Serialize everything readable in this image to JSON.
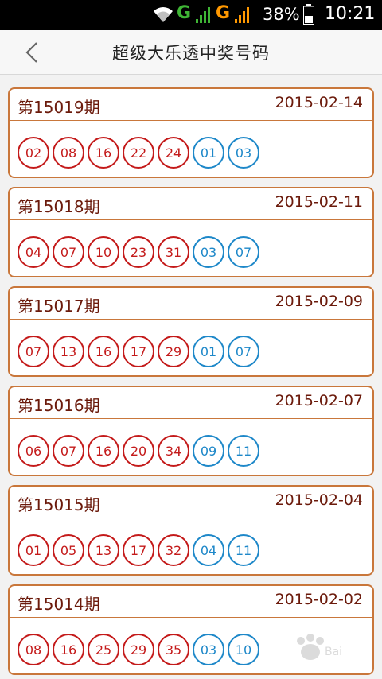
{
  "status": {
    "network1": "G",
    "network2": "G",
    "battery_percent": "38%",
    "time": "10:21"
  },
  "header": {
    "back_icon": "chevron-left-icon",
    "title": "超级大乐透中奖号码"
  },
  "draws": [
    {
      "issue": "第15019期",
      "date": "2015-02-14",
      "front": [
        "02",
        "08",
        "16",
        "22",
        "24"
      ],
      "back": [
        "01",
        "03"
      ]
    },
    {
      "issue": "第15018期",
      "date": "2015-02-11",
      "front": [
        "04",
        "07",
        "10",
        "23",
        "31"
      ],
      "back": [
        "03",
        "07"
      ]
    },
    {
      "issue": "第15017期",
      "date": "2015-02-09",
      "front": [
        "07",
        "13",
        "16",
        "17",
        "29"
      ],
      "back": [
        "01",
        "07"
      ]
    },
    {
      "issue": "第15016期",
      "date": "2015-02-07",
      "front": [
        "06",
        "07",
        "16",
        "20",
        "34"
      ],
      "back": [
        "09",
        "11"
      ]
    },
    {
      "issue": "第15015期",
      "date": "2015-02-04",
      "front": [
        "01",
        "05",
        "13",
        "17",
        "32"
      ],
      "back": [
        "04",
        "11"
      ]
    },
    {
      "issue": "第15014期",
      "date": "2015-02-02",
      "front": [
        "08",
        "16",
        "25",
        "29",
        "35"
      ],
      "back": [
        "03",
        "10"
      ]
    }
  ],
  "colors": {
    "front_ball": "#c41a1a",
    "back_ball": "#1e88c9",
    "card_border": "#c9773b",
    "issue_text": "#6b1a0b"
  }
}
